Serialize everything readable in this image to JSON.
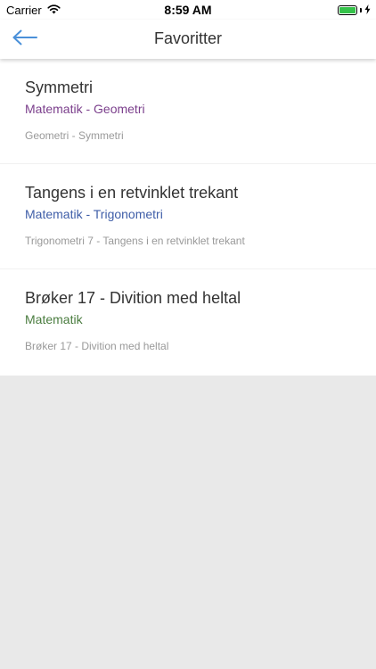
{
  "status_bar": {
    "carrier": "Carrier",
    "time": "8:59 AM",
    "battery_level": 1.0
  },
  "nav": {
    "title": "Favoritter",
    "back_icon": "arrow-left-icon",
    "accent": "#4a90d9"
  },
  "favorites": [
    {
      "title": "Symmetri",
      "subject": "Matematik - Geometri",
      "subject_color": "#7b3f8c",
      "path": "Geometri - Symmetri"
    },
    {
      "title": "Tangens i en retvinklet trekant",
      "subject": "Matematik - Trigonometri",
      "subject_color": "#3f5ea8",
      "path": "Trigonometri 7 - Tangens i en retvinklet trekant"
    },
    {
      "title": "Brøker 17 - Divition med heltal",
      "subject": "Matematik",
      "subject_color": "#4a7c3f",
      "path": "Brøker 17 - Divition med heltal"
    }
  ]
}
